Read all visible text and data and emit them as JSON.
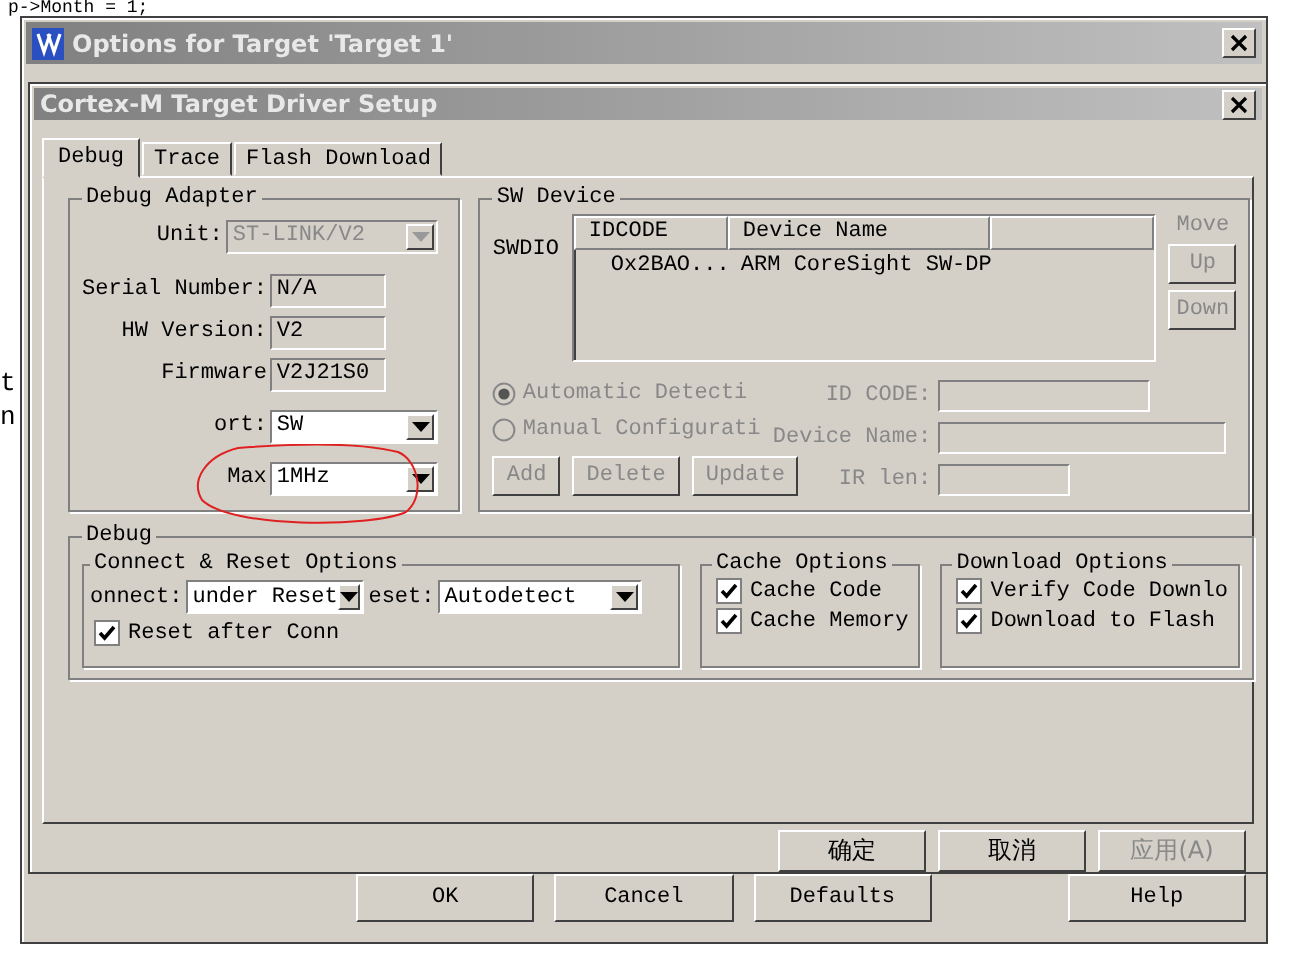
{
  "background_editor": {
    "code_line": "p->Month = 1;",
    "fragments": [
      "t",
      "n"
    ]
  },
  "window": {
    "title": "Options for Target 'Target 1'"
  },
  "dialog": {
    "title": "Cortex-M Target Driver Setup"
  },
  "tabs": [
    {
      "label": "Debug",
      "selected": true
    },
    {
      "label": "Trace",
      "selected": false
    },
    {
      "label": "Flash Download",
      "selected": false
    }
  ],
  "debug_adapter": {
    "title": "Debug Adapter",
    "fields": [
      {
        "label": "Unit:",
        "value": "ST-LINK/V2",
        "kind": "dropdown",
        "disabled": true
      },
      {
        "label": "Serial Number:",
        "value": "N/A",
        "kind": "readonly"
      },
      {
        "label": "HW Version:",
        "value": "V2",
        "kind": "readonly"
      },
      {
        "label": "Firmware",
        "value": "V2J21S0",
        "kind": "readonly"
      },
      {
        "label": "ort:",
        "value": "SW",
        "kind": "dropdown",
        "disabled": false
      },
      {
        "label": "Max",
        "value": "1MHz",
        "kind": "dropdown",
        "disabled": false
      }
    ]
  },
  "sw_device": {
    "title": "SW Device",
    "port_label": "SWDIO",
    "columns": [
      "IDCODE",
      "Device Name"
    ],
    "rows": [
      [
        "Ox2BAO...",
        "ARM CoreSight SW-DP"
      ]
    ],
    "move_label": "Move",
    "move_buttons": [
      {
        "label": "Up",
        "disabled": true
      },
      {
        "label": "Down",
        "disabled": true
      }
    ],
    "modes": [
      {
        "label": "Automatic Detecti",
        "selected": true,
        "disabled": true
      },
      {
        "label": "Manual Configurati",
        "selected": false,
        "disabled": true
      }
    ],
    "id_fields": [
      {
        "label": "ID CODE:",
        "disabled": true
      },
      {
        "label": "Device Name:",
        "disabled": true
      },
      {
        "label": "IR len:",
        "disabled": true
      }
    ],
    "buttons": [
      {
        "label": "Add",
        "disabled": true
      },
      {
        "label": "Delete",
        "disabled": true
      },
      {
        "label": "Update",
        "disabled": true
      }
    ]
  },
  "debug": {
    "title": "Debug",
    "connect_reset": {
      "title": "Connect & Reset Options",
      "connect_label": "onnect:",
      "connect_value": "under Reset",
      "reset_label": "eset:",
      "reset_value": "Autodetect",
      "checks": [
        {
          "label": "Reset after Conn",
          "checked": true
        }
      ]
    },
    "cache_options": {
      "title": "Cache Options",
      "checks": [
        {
          "label": "Cache Code",
          "checked": true
        },
        {
          "label": "Cache Memory",
          "checked": true
        }
      ]
    },
    "download_options": {
      "title": "Download Options",
      "checks": [
        {
          "label": "Verify Code Downlo",
          "checked": true
        },
        {
          "label": "Download to Flash",
          "checked": true
        }
      ]
    }
  },
  "dialog_buttons": [
    {
      "label": "确定",
      "disabled": false
    },
    {
      "label": "取消",
      "disabled": false
    },
    {
      "label": "应用(A)",
      "disabled": true
    }
  ],
  "window_buttons": [
    {
      "label": "OK"
    },
    {
      "label": "Cancel"
    },
    {
      "label": "Defaults"
    },
    {
      "label": "Help"
    }
  ]
}
